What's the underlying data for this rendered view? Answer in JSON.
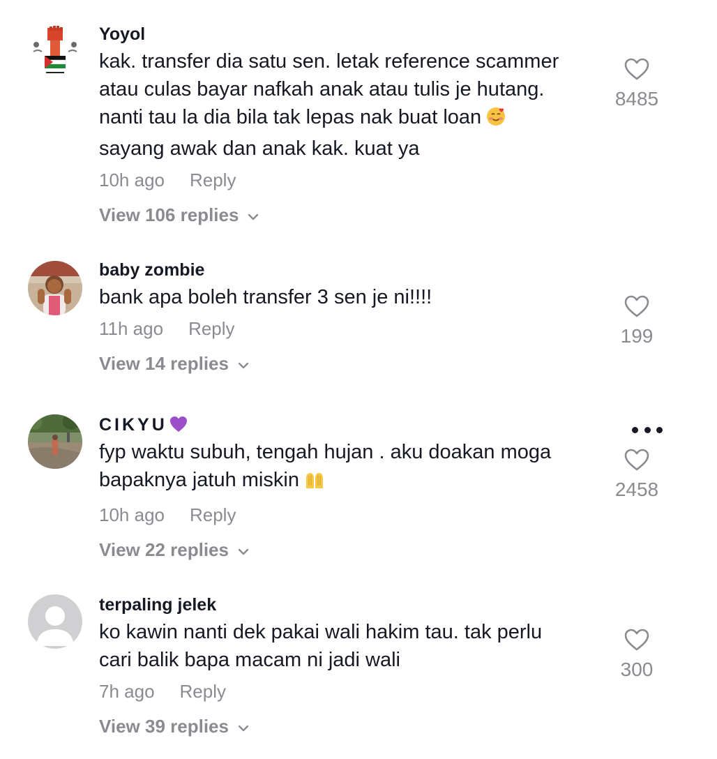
{
  "comments": [
    {
      "username": "Yoyol",
      "text_lines": [
        "kak. transfer dia satu sen. letak reference scammer",
        "atau culas bayar nafkah anak atau tulis je hutang.",
        "nanti tau la dia bila tak lepas nak buat loan",
        "sayang awak dan anak kak. kuat ya"
      ],
      "time": "10h ago",
      "reply_label": "Reply",
      "view_replies": "View 106 replies",
      "likes": "8485",
      "avatar_icon": "fist-flag-avatar",
      "emoji_icon": "smiling-face-with-hearts-emoji"
    },
    {
      "username": "baby zombie",
      "text_lines": [
        "bank apa boleh transfer 3 sen je ni!!!!"
      ],
      "time": "11h ago",
      "reply_label": "Reply",
      "view_replies": "View 14 replies",
      "likes": "199",
      "avatar_icon": "child-photo-avatar"
    },
    {
      "username": "CIKYU",
      "text_lines": [
        "fyp waktu subuh, tengah hujan . aku doakan moga",
        "bapaknya jatuh miskin"
      ],
      "time": "10h ago",
      "reply_label": "Reply",
      "view_replies": "View 22 replies",
      "likes": "2458",
      "avatar_icon": "outdoor-photo-avatar",
      "emoji_icon": "praying-hands-emoji",
      "name_emoji_icon": "purple-heart-emoji"
    },
    {
      "username": "terpaling jelek",
      "text_lines": [
        "ko kawin nanti dek pakai wali hakim tau. tak perlu",
        "cari balik bapa macam ni jadi wali"
      ],
      "time": "7h ago",
      "reply_label": "Reply",
      "view_replies": "View 39 replies",
      "likes": "300",
      "avatar_icon": "default-user-avatar"
    }
  ],
  "colors": {
    "text": "#161823",
    "muted": "#8a8b91",
    "background": "#ffffff"
  }
}
